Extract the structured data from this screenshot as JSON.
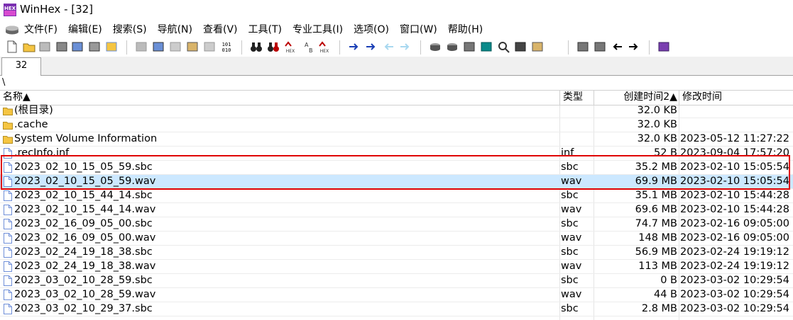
{
  "window": {
    "title": "WinHex - [32]"
  },
  "menu": {
    "items": [
      "文件(F)",
      "编辑(E)",
      "搜索(S)",
      "导航(N)",
      "查看(V)",
      "工具(T)",
      "专业工具(I)",
      "选项(O)",
      "窗口(W)",
      "帮助(H)"
    ]
  },
  "tabs": [
    {
      "label": "32"
    }
  ],
  "path": "\\",
  "columns": {
    "name": "名称▲",
    "type": "类型",
    "created": "创建时间2▲",
    "modified": "修改时间"
  },
  "rows": [
    {
      "icon": "folder",
      "name": "(根目录)",
      "type": "",
      "size": "32.0 KB",
      "modified": ""
    },
    {
      "icon": "folder",
      "name": ".cache",
      "type": "",
      "size": "32.0 KB",
      "modified": ""
    },
    {
      "icon": "folder",
      "name": "System Volume Information",
      "type": "",
      "size": "32.0 KB",
      "modified": "2023-05-12  11:27:22"
    },
    {
      "icon": "file",
      "name": ".recInfo.inf",
      "type": "inf",
      "size": "52 B",
      "modified": "2023-09-04  17:57:20"
    },
    {
      "icon": "file",
      "name": "2023_02_10_15_05_59.sbc",
      "type": "sbc",
      "size": "35.2 MB",
      "modified": "2023-02-10  15:05:54"
    },
    {
      "icon": "file",
      "name": "2023_02_10_15_05_59.wav",
      "type": "wav",
      "size": "69.9 MB",
      "modified": "2023-02-10  15:05:54",
      "selected": true
    },
    {
      "icon": "file",
      "name": "2023_02_10_15_44_14.sbc",
      "type": "sbc",
      "size": "35.1 MB",
      "modified": "2023-02-10  15:44:28"
    },
    {
      "icon": "file",
      "name": "2023_02_10_15_44_14.wav",
      "type": "wav",
      "size": "69.6 MB",
      "modified": "2023-02-10  15:44:28"
    },
    {
      "icon": "file",
      "name": "2023_02_16_09_05_00.sbc",
      "type": "sbc",
      "size": "74.7 MB",
      "modified": "2023-02-16  09:05:00"
    },
    {
      "icon": "file",
      "name": "2023_02_16_09_05_00.wav",
      "type": "wav",
      "size": "148 MB",
      "modified": "2023-02-16  09:05:00"
    },
    {
      "icon": "file",
      "name": "2023_02_24_19_18_38.sbc",
      "type": "sbc",
      "size": "56.9 MB",
      "modified": "2023-02-24  19:19:12"
    },
    {
      "icon": "file",
      "name": "2023_02_24_19_18_38.wav",
      "type": "wav",
      "size": "113 MB",
      "modified": "2023-02-24  19:19:12"
    },
    {
      "icon": "file",
      "name": "2023_03_02_10_28_59.sbc",
      "type": "sbc",
      "size": "0 B",
      "modified": "2023-03-02  10:29:54"
    },
    {
      "icon": "file",
      "name": "2023_03_02_10_28_59.wav",
      "type": "wav",
      "size": "44 B",
      "modified": "2023-03-02  10:29:54"
    },
    {
      "icon": "file",
      "name": "2023_03_02_10_29_37.sbc",
      "type": "sbc",
      "size": "2.8 MB",
      "modified": "2023-03-02  10:29:54"
    }
  ],
  "colors": {
    "selection": "#cce8ff",
    "highlight_box": "#e00000",
    "folder": "#f5c542",
    "file": "#6f8fd8"
  }
}
